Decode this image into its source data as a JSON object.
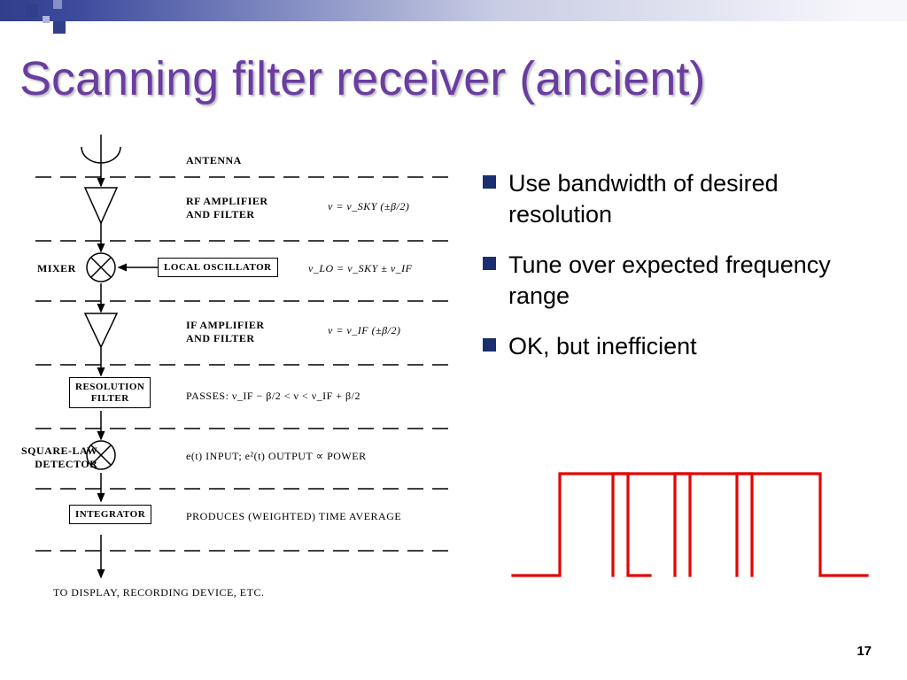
{
  "header": {
    "title": "Scanning filter receiver (ancient)"
  },
  "bullets": [
    "Use bandwidth of desired resolution",
    "Tune over expected frequency range",
    "OK, but inefficient"
  ],
  "diagram": {
    "antenna": "ANTENNA",
    "rf_amp": "RF AMPLIFIER\nAND FILTER",
    "rf_eq": "ν = ν_SKY  (±β/2)",
    "mixer": "MIXER",
    "local_osc": "LOCAL OSCILLATOR",
    "lo_eq": "ν_LO = ν_SKY ± ν_IF",
    "if_amp": "IF AMPLIFIER\nAND FILTER",
    "if_eq": "ν = ν_IF  (±β/2)",
    "res_filter": "RESOLUTION\nFILTER",
    "passes": "PASSES:  ν_IF − β/2 < ν < ν_IF + β/2",
    "sqlaw": "SQUARE-LAW\nDETECTOR",
    "sqlaw_eq": "e(t) INPUT; e²(t) OUTPUT ∝ POWER",
    "integrator": "INTEGRATOR",
    "integrator_eq": "PRODUCES (WEIGHTED) TIME AVERAGE",
    "output": "TO DISPLAY, RECORDING DEVICE, ETC."
  },
  "page_number": "17"
}
